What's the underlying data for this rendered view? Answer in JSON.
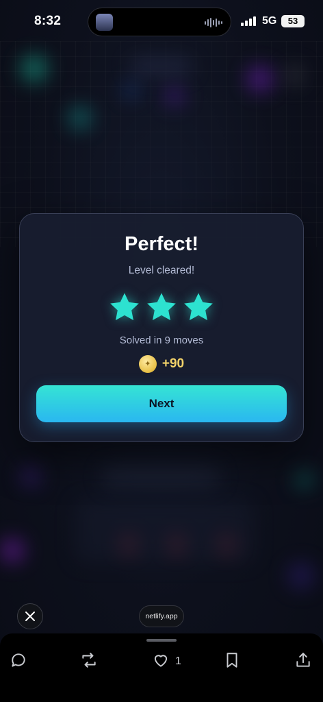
{
  "status_bar": {
    "time": "8:32",
    "network": "5G",
    "battery": "53"
  },
  "modal": {
    "title": "Perfect!",
    "subtitle": "Level cleared!",
    "stars_earned": 3,
    "stars_total": 3,
    "moves_text": "Solved in 9 moves",
    "reward_text": "+90",
    "next_label": "Next"
  },
  "browser": {
    "url": "netlify.app"
  },
  "action_bar": {
    "like_count": "1"
  },
  "colors": {
    "star": "#2de2d0",
    "button_top": "#35e4d4",
    "button_bottom": "#2ab7f0",
    "coin": "#e7bf45"
  }
}
